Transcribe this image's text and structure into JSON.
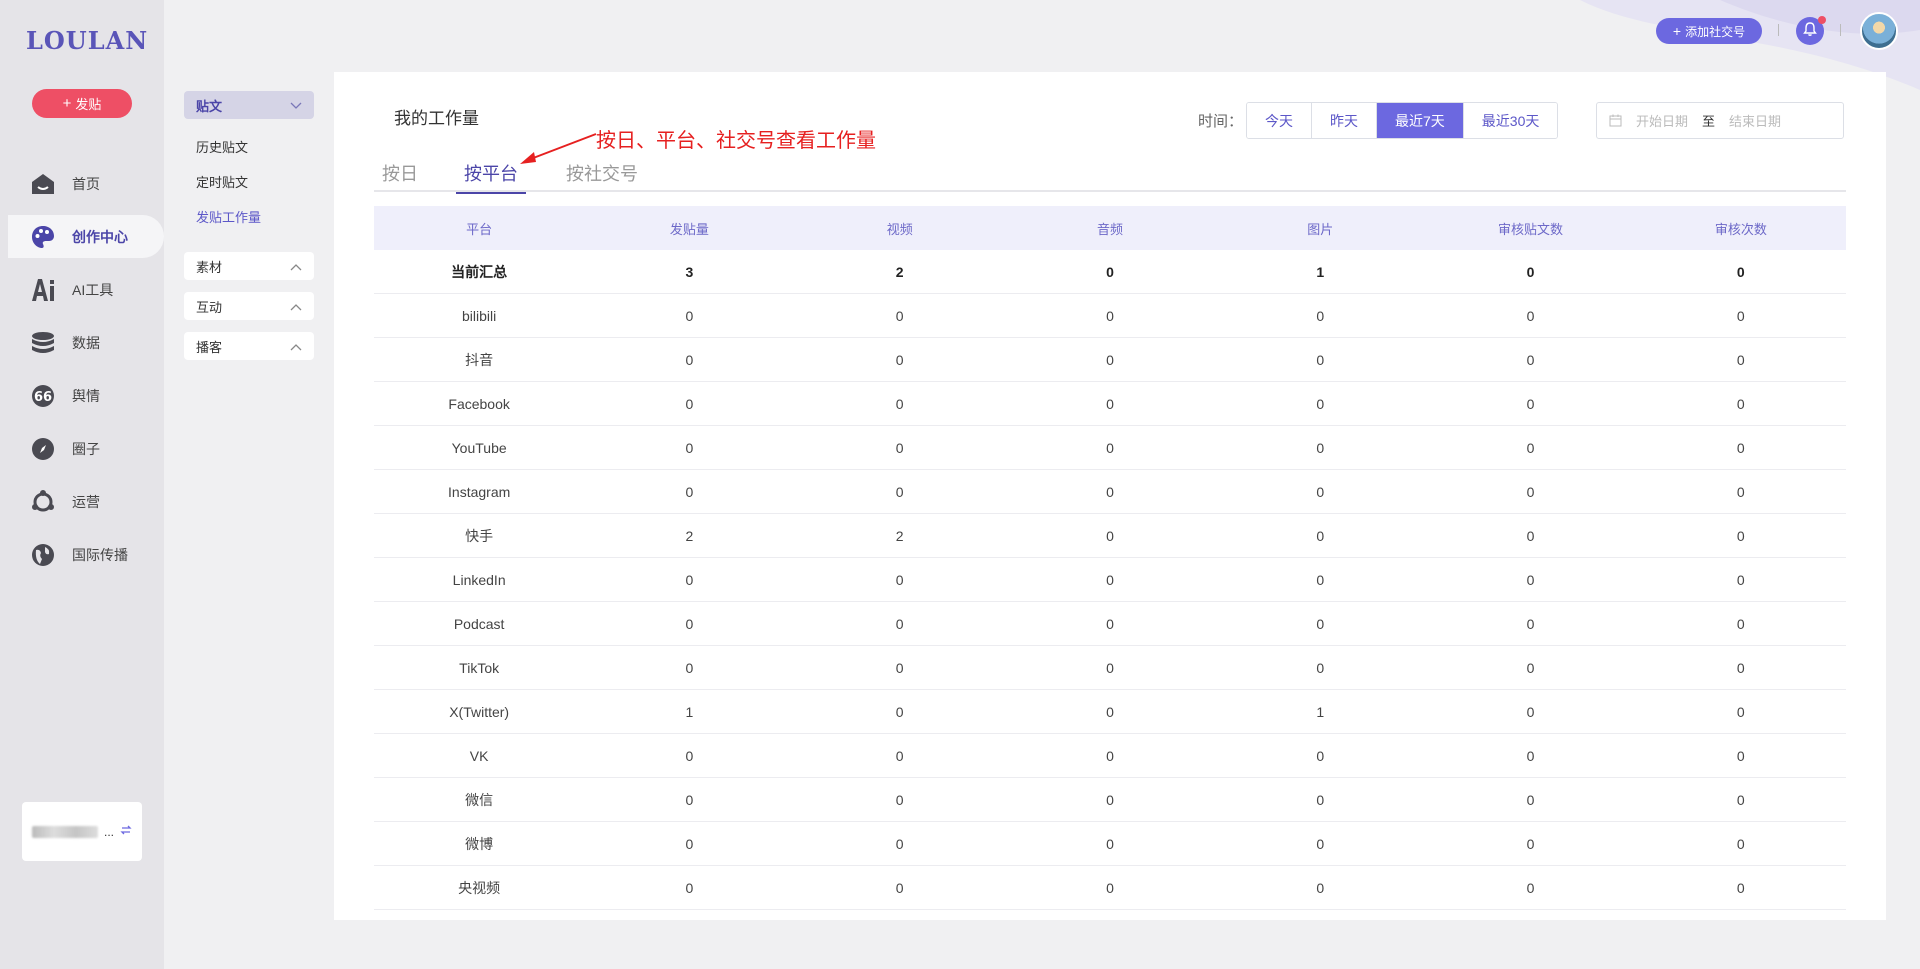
{
  "brand": {
    "logo": "LOULAN"
  },
  "leftnav": {
    "post_button": "发贴",
    "items": [
      {
        "label": "首页",
        "icon": "home-icon"
      },
      {
        "label": "创作中心",
        "icon": "palette-icon",
        "active": true
      },
      {
        "label": "AI工具",
        "icon": "ai-icon"
      },
      {
        "label": "数据",
        "icon": "database-icon"
      },
      {
        "label": "舆情",
        "icon": "quote-icon"
      },
      {
        "label": "圈子",
        "icon": "compass-icon"
      },
      {
        "label": "运营",
        "icon": "operation-icon"
      },
      {
        "label": "国际传播",
        "icon": "globe-icon"
      }
    ],
    "account_text": "..."
  },
  "submenu": {
    "group_posts": "贴文",
    "items": [
      "历史贴文",
      "定时贴文",
      "发贴工作量"
    ],
    "group_material": "素材",
    "group_interaction": "互动",
    "group_podcast": "播客"
  },
  "topbar": {
    "add_social": "添加社交号"
  },
  "main": {
    "title": "我的工作量",
    "annotation": "按日、平台、社交号查看工作量",
    "tabs": [
      "按日",
      "按平台",
      "按社交号"
    ],
    "time_label": "时间：",
    "ranges": [
      "今天",
      "昨天",
      "最近7天",
      "最近30天"
    ],
    "date_start_placeholder": "开始日期",
    "date_separator": "至",
    "date_end_placeholder": "结束日期",
    "columns": [
      "平台",
      "发贴量",
      "视频",
      "音频",
      "图片",
      "审核贴文数",
      "审核次数"
    ],
    "rows": [
      [
        "当前汇总",
        "3",
        "2",
        "0",
        "1",
        "0",
        "0"
      ],
      [
        "bilibili",
        "0",
        "0",
        "0",
        "0",
        "0",
        "0"
      ],
      [
        "抖音",
        "0",
        "0",
        "0",
        "0",
        "0",
        "0"
      ],
      [
        "Facebook",
        "0",
        "0",
        "0",
        "0",
        "0",
        "0"
      ],
      [
        "YouTube",
        "0",
        "0",
        "0",
        "0",
        "0",
        "0"
      ],
      [
        "Instagram",
        "0",
        "0",
        "0",
        "0",
        "0",
        "0"
      ],
      [
        "快手",
        "2",
        "2",
        "0",
        "0",
        "0",
        "0"
      ],
      [
        "LinkedIn",
        "0",
        "0",
        "0",
        "0",
        "0",
        "0"
      ],
      [
        "Podcast",
        "0",
        "0",
        "0",
        "0",
        "0",
        "0"
      ],
      [
        "TikTok",
        "0",
        "0",
        "0",
        "0",
        "0",
        "0"
      ],
      [
        "X(Twitter)",
        "1",
        "0",
        "0",
        "1",
        "0",
        "0"
      ],
      [
        "VK",
        "0",
        "0",
        "0",
        "0",
        "0",
        "0"
      ],
      [
        "微信",
        "0",
        "0",
        "0",
        "0",
        "0",
        "0"
      ],
      [
        "微博",
        "0",
        "0",
        "0",
        "0",
        "0",
        "0"
      ],
      [
        "央视频",
        "0",
        "0",
        "0",
        "0",
        "0",
        "0"
      ]
    ]
  },
  "colors": {
    "accent": "#6c68e0",
    "brand_dark": "#4b45a8",
    "post_red": "#ee4f65",
    "annotation_red": "#e62020"
  }
}
